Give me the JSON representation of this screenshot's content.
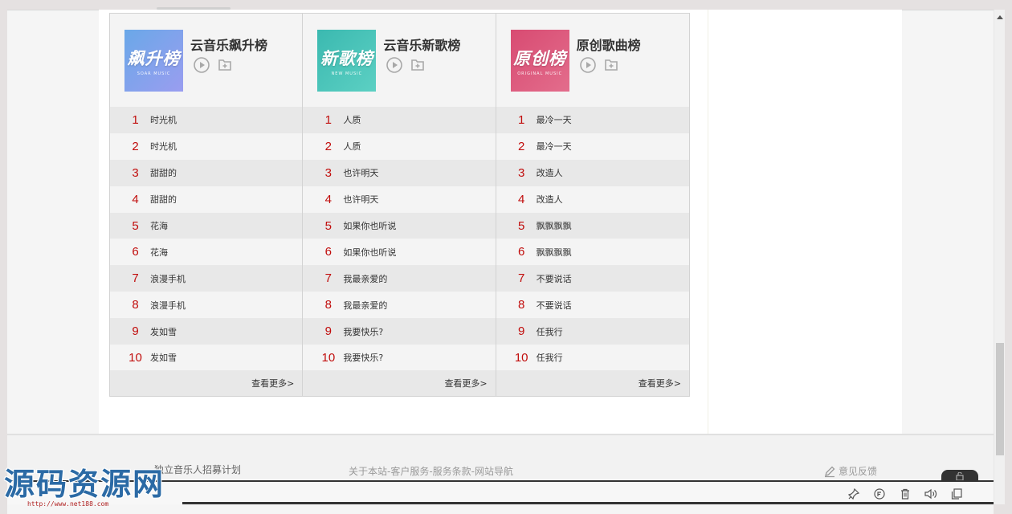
{
  "toplists": [
    {
      "title": "云音乐飙升榜",
      "cover_title": "飙升榜",
      "cover_sub": "SOAR MUSIC",
      "songs": [
        "时光机",
        "时光机",
        "甜甜的",
        "甜甜的",
        "花海",
        "花海",
        "浪漫手机",
        "浪漫手机",
        "发如雪",
        "发如雪"
      ],
      "more": "查看更多>"
    },
    {
      "title": "云音乐新歌榜",
      "cover_title": "新歌榜",
      "cover_sub": "NEW MUSIC",
      "songs": [
        "人质",
        "人质",
        "也许明天",
        "也许明天",
        "如果你也听说",
        "如果你也听说",
        "我最亲爱的",
        "我最亲爱的",
        "我要快乐?",
        "我要快乐?"
      ],
      "more": "查看更多>"
    },
    {
      "title": "原创歌曲榜",
      "cover_title": "原创榜",
      "cover_sub": "ORIGINAL MUSIC",
      "songs": [
        "最冷一天",
        "最冷一天",
        "改造人",
        "改造人",
        "飘飘飘飘",
        "飘飘飘飘",
        "不要说话",
        "不要说话",
        "任我行",
        "任我行"
      ],
      "more": "查看更多>"
    }
  ],
  "ranks": [
    "1",
    "2",
    "3",
    "4",
    "5",
    "6",
    "7",
    "8",
    "9",
    "10"
  ],
  "footer": {
    "recruit": "独立音乐人招募计划",
    "links": "关于本站-客户服务-服务条款-网站导航",
    "feedback": "意见反馈"
  },
  "watermark": {
    "text": "源码资源网",
    "url": "http://www.net188.com"
  },
  "colors": {
    "rank": "#c10d0c",
    "player_bar": "#333333"
  }
}
